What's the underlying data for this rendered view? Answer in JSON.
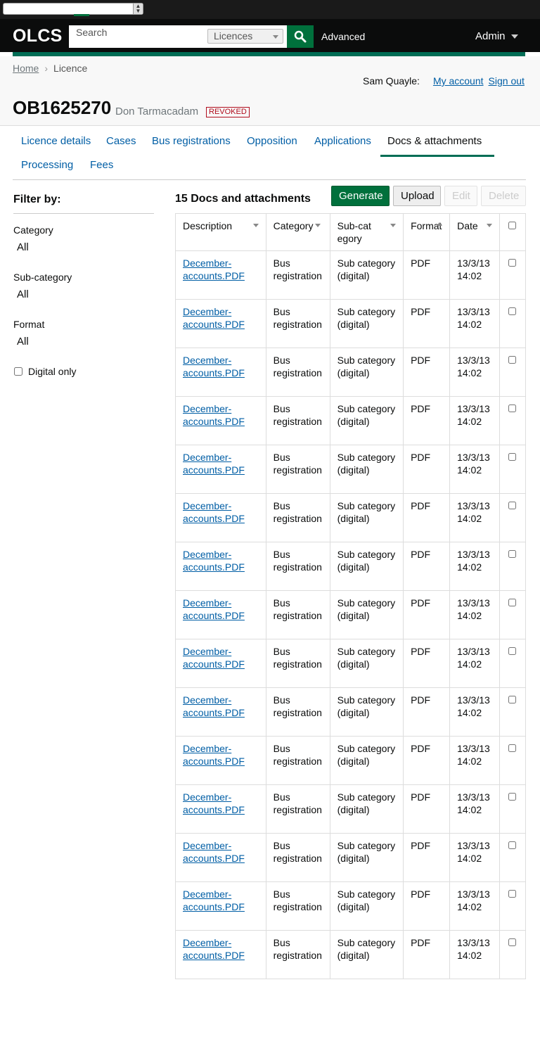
{
  "header": {
    "logo": "OLCS",
    "search_placeholder": "Search",
    "search_scope": "Licences",
    "advanced_label": "Advanced",
    "admin_label": "Admin"
  },
  "breadcrumb": {
    "home": "Home",
    "current": "Licence"
  },
  "user": {
    "name": "Sam Quayle:",
    "my_account": "My account",
    "sign_out": "Sign out"
  },
  "licence": {
    "number": "OB1625270",
    "holder": "Don Tarmacadam",
    "status": "REVOKED"
  },
  "tabs": [
    {
      "label": "Licence details"
    },
    {
      "label": "Cases"
    },
    {
      "label": "Bus registrations"
    },
    {
      "label": "Opposition"
    },
    {
      "label": "Applications"
    },
    {
      "label": "Docs & attachments"
    },
    {
      "label": "Processing"
    },
    {
      "label": "Fees"
    }
  ],
  "filters": {
    "title": "Filter by:",
    "category_label": "Category",
    "category_value": "All",
    "subcategory_label": "Sub-category",
    "subcategory_value": "All",
    "format_label": "Format",
    "format_value": "All",
    "digital_only_label": "Digital only"
  },
  "docs": {
    "title": "15 Docs and attachments",
    "generate": "Generate",
    "upload": "Upload",
    "edit": "Edit",
    "delete": "Delete",
    "columns": {
      "description": "Description",
      "category": "Category",
      "subcategory": "Sub-category",
      "format": "Format",
      "date": "Date"
    },
    "rows": [
      {
        "description": "December-accounts.PDF",
        "category": "Bus registration",
        "subcategory": "Sub category (digital)",
        "format": "PDF",
        "date": "13/3/13 14:02"
      },
      {
        "description": "December-accounts.PDF",
        "category": "Bus registration",
        "subcategory": "Sub category (digital)",
        "format": "PDF",
        "date": "13/3/13 14:02"
      },
      {
        "description": "December-accounts.PDF",
        "category": "Bus registration",
        "subcategory": "Sub category (digital)",
        "format": "PDF",
        "date": "13/3/13 14:02"
      },
      {
        "description": "December-accounts.PDF",
        "category": "Bus registration",
        "subcategory": "Sub category (digital)",
        "format": "PDF",
        "date": "13/3/13 14:02"
      },
      {
        "description": "December-accounts.PDF",
        "category": "Bus registration",
        "subcategory": "Sub category (digital)",
        "format": "PDF",
        "date": "13/3/13 14:02"
      },
      {
        "description": "December-accounts.PDF",
        "category": "Bus registration",
        "subcategory": "Sub category (digital)",
        "format": "PDF",
        "date": "13/3/13 14:02"
      },
      {
        "description": "December-accounts.PDF",
        "category": "Bus registration",
        "subcategory": "Sub category (digital)",
        "format": "PDF",
        "date": "13/3/13 14:02"
      },
      {
        "description": "December-accounts.PDF",
        "category": "Bus registration",
        "subcategory": "Sub category (digital)",
        "format": "PDF",
        "date": "13/3/13 14:02"
      },
      {
        "description": "December-accounts.PDF",
        "category": "Bus registration",
        "subcategory": "Sub category (digital)",
        "format": "PDF",
        "date": "13/3/13 14:02"
      },
      {
        "description": "December-accounts.PDF",
        "category": "Bus registration",
        "subcategory": "Sub category (digital)",
        "format": "PDF",
        "date": "13/3/13 14:02"
      },
      {
        "description": "December-accounts.PDF",
        "category": "Bus registration",
        "subcategory": "Sub category (digital)",
        "format": "PDF",
        "date": "13/3/13 14:02"
      },
      {
        "description": "December-accounts.PDF",
        "category": "Bus registration",
        "subcategory": "Sub category (digital)",
        "format": "PDF",
        "date": "13/3/13 14:02"
      },
      {
        "description": "December-accounts.PDF",
        "category": "Bus registration",
        "subcategory": "Sub category (digital)",
        "format": "PDF",
        "date": "13/3/13 14:02"
      },
      {
        "description": "December-accounts.PDF",
        "category": "Bus registration",
        "subcategory": "Sub category (digital)",
        "format": "PDF",
        "date": "13/3/13 14:02"
      },
      {
        "description": "December-accounts.PDF",
        "category": "Bus registration",
        "subcategory": "Sub category (digital)",
        "format": "PDF",
        "date": "13/3/13 14:02"
      }
    ]
  },
  "colors": {
    "brand_green": "#006d55",
    "button_green": "#00703c",
    "link_blue": "#005ea5",
    "revoked_red": "#b10e1e",
    "header_black": "#0b0c0c"
  }
}
